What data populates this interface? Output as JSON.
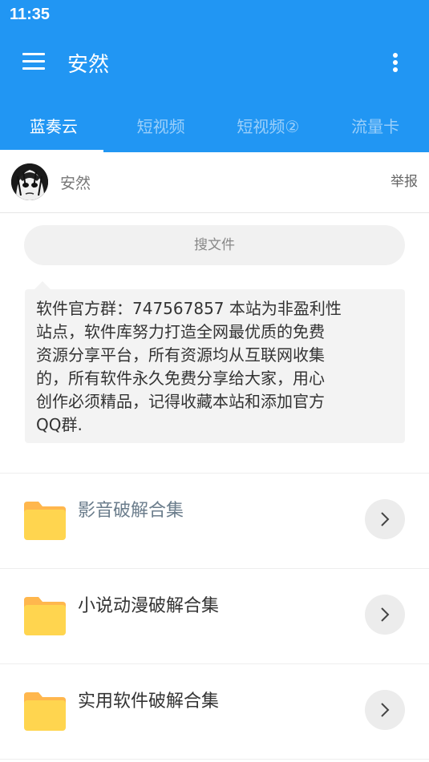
{
  "status_bar": {
    "time": "11:35"
  },
  "app_bar": {
    "title": "安然",
    "menu_icon": "hamburger-menu-icon",
    "more_icon": "more-vertical-icon",
    "background_color": "#2196f3"
  },
  "tabs": [
    {
      "label": "蓝奏云",
      "active": true
    },
    {
      "label": "短视频",
      "active": false
    },
    {
      "label": "短视频②",
      "active": false
    },
    {
      "label": "流量卡",
      "active": false
    }
  ],
  "author": {
    "name": "安然",
    "report_label": "举报",
    "avatar_icon": "avatar-image"
  },
  "search": {
    "placeholder": "搜文件"
  },
  "notice": {
    "lines": [
      "软件官方群：747567857 本站为非盈利性",
      "站点，软件库努力打造全网最优质的免费",
      "资源分享平台，所有资源均从互联网收集",
      "的，所有软件永久免费分享给大家，用心",
      "创作必须精品，记得收藏本站和添加官方",
      "QQ群."
    ]
  },
  "folders": [
    {
      "name": "影音破解合集",
      "icon": "folder-icon",
      "action_icon": "chevron-right-icon"
    },
    {
      "name": "小说动漫破解合集",
      "icon": "folder-icon",
      "action_icon": "chevron-right-icon"
    },
    {
      "name": "实用软件破解合集",
      "icon": "folder-icon",
      "action_icon": "chevron-right-icon"
    }
  ],
  "colors": {
    "primary": "#2196f3",
    "folder_yellow": "#ffd54f",
    "folder_tab": "#ffb74d"
  }
}
